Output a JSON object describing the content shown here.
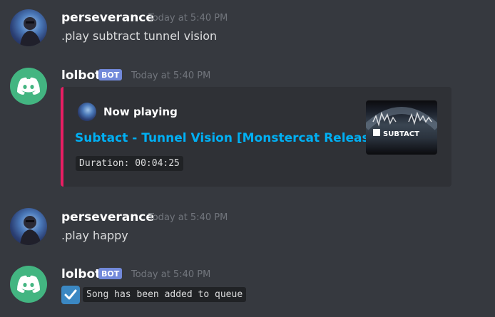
{
  "messages": [
    {
      "username": "perseverance",
      "timestamp": "Today at 5:40 PM",
      "content": ".play subtract tunnel vision"
    },
    {
      "username": "lolbot",
      "bot_tag": "BOT",
      "timestamp": "Today at 5:40 PM",
      "embed": {
        "author": "Now playing",
        "title": "Subtact - Tunnel Vision [Monstercat Release]",
        "duration": "Duration: 00:04:25",
        "thumbnail_text": "SUBTACT",
        "accent_color": "#e91e63"
      }
    },
    {
      "username": "perseverance",
      "timestamp": "Today at 5:40 PM",
      "content": ".play happy"
    },
    {
      "username": "lolbot",
      "bot_tag": "BOT",
      "timestamp": "Today at 5:40 PM",
      "content": "Song has been added to queue",
      "check_icon": "white-check-mark-emoji"
    }
  ],
  "colors": {
    "background": "#36393f",
    "embed_background": "#2f3136",
    "link": "#00b0f4",
    "bot_tag": "#7289da",
    "bot_avatar": "#43b581"
  }
}
